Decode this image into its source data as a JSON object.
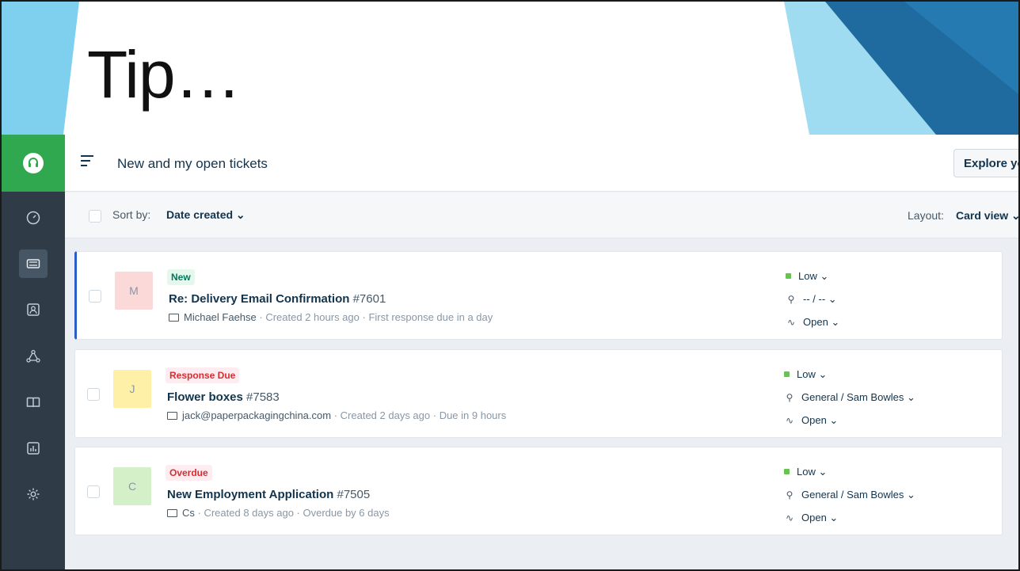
{
  "slide": {
    "title": "Tip…"
  },
  "app": {
    "header": {
      "title": "New and my open tickets",
      "explore_label": "Explore yo"
    },
    "sort": {
      "label": "Sort by:",
      "value": "Date created ⌄",
      "layout_label": "Layout:",
      "layout_value": "Card view ⌄"
    },
    "sidebar": {
      "icons": [
        "dashboard-icon",
        "tickets-icon",
        "contacts-icon",
        "solutions-icon",
        "knowledge-base-icon",
        "reports-icon",
        "settings-icon"
      ]
    },
    "tickets": [
      {
        "avatar": "M",
        "avatar_color": "#fbd9d9",
        "status_badge": "New",
        "badge_bg": "#e5f8ee",
        "badge_fg": "#00795b",
        "subject": "Re: Delivery Email Confirmation",
        "number": "#7601",
        "requester": "Michael Faehse",
        "created": "Created 2 hours ago",
        "due": "First response due in a day",
        "priority": "Low ⌄",
        "group_agent": "-- / -- ⌄",
        "status": "Open ⌄"
      },
      {
        "avatar": "J",
        "avatar_color": "#fef1a7",
        "status_badge": "Response Due",
        "badge_bg": "#ffecf0",
        "badge_fg": "#d72d30",
        "subject": "Flower boxes",
        "number": "#7583",
        "requester": "jack@paperpackagingchina.com",
        "created": "Created 2 days ago",
        "due": "Due in 9 hours",
        "priority": "Low ⌄",
        "group_agent": "General / Sam Bowles ⌄",
        "status": "Open ⌄"
      },
      {
        "avatar": "C",
        "avatar_color": "#d3f0c9",
        "status_badge": "Overdue",
        "badge_bg": "#ffecf0",
        "badge_fg": "#d72d30",
        "subject": "New Employment Application",
        "number": "#7505",
        "requester": "Cs",
        "created": "Created 8 days ago",
        "due": "Overdue by 6 days",
        "priority": "Low ⌄",
        "group_agent": "General / Sam Bowles ⌄",
        "status": "Open ⌄"
      }
    ]
  }
}
